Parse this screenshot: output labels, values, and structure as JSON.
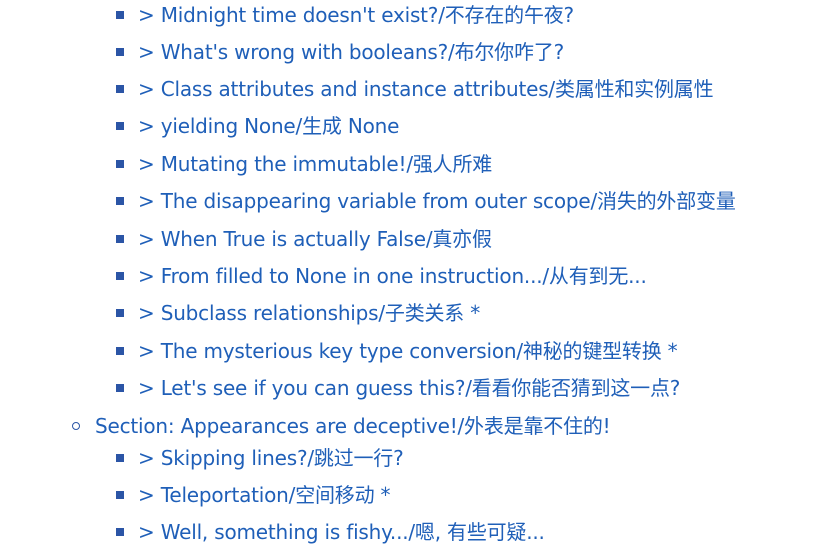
{
  "items": [
    {
      "text": "> Midnight time doesn't exist?/不存在的午夜?"
    },
    {
      "text": "> What's wrong with booleans?/布尔你咋了?"
    },
    {
      "text": "> Class attributes and instance attributes/类属性和实例属性"
    },
    {
      "text": "> yielding None/生成 None"
    },
    {
      "text": "> Mutating the immutable!/强人所难"
    },
    {
      "text": "> The disappearing variable from outer scope/消失的外部变量"
    },
    {
      "text": "> When True is actually False/真亦假"
    },
    {
      "text": "> From filled to None in one instruction.../从有到无..."
    },
    {
      "text": "> Subclass relationships/子类关系 *"
    },
    {
      "text": "> The mysterious key type conversion/神秘的键型转换 *"
    },
    {
      "text": "> Let's see if you can guess this?/看看你能否猜到这一点?"
    }
  ],
  "section": {
    "text": "Section: Appearances are deceptive!/外表是靠不住的!"
  },
  "section_items": [
    {
      "text": "> Skipping lines?/跳过一行?"
    },
    {
      "text": "> Teleportation/空间移动 *"
    },
    {
      "text": "> Well, something is fishy.../嗯, 有些可疑..."
    }
  ],
  "colors": {
    "link": "#1f5fb8",
    "bullet": "#2b55a6"
  }
}
